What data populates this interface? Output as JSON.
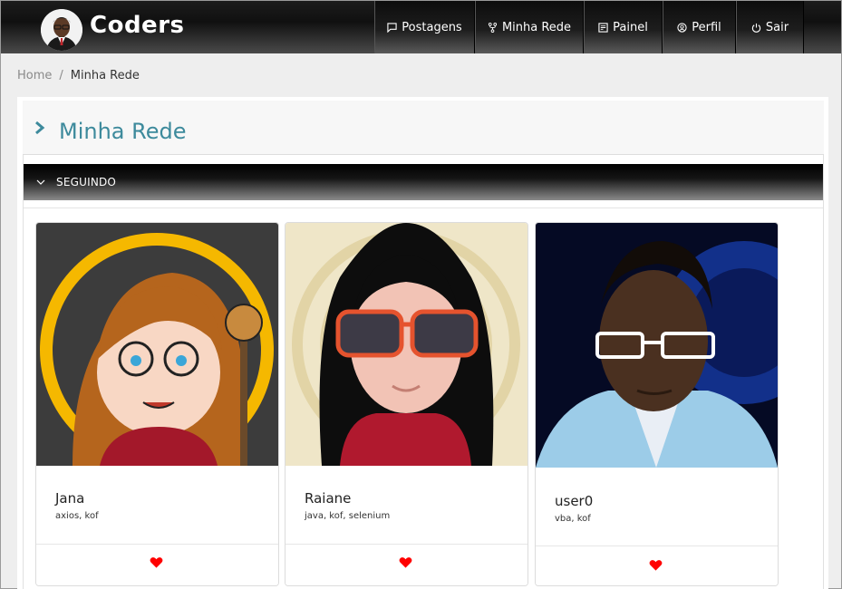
{
  "header": {
    "brand": "Coders",
    "nav": [
      {
        "label": "Postagens",
        "icon": "chat-icon"
      },
      {
        "label": "Minha Rede",
        "icon": "network-icon"
      },
      {
        "label": "Painel",
        "icon": "dashboard-icon"
      },
      {
        "label": "Perfil",
        "icon": "user-circle-icon"
      },
      {
        "label": "Sair",
        "icon": "power-icon"
      }
    ]
  },
  "breadcrumb": {
    "home": "Home",
    "separator": "/",
    "current": "Minha Rede"
  },
  "page": {
    "title": "Minha Rede"
  },
  "section": {
    "label": "SEGUINDO"
  },
  "cards": [
    {
      "name": "Jana",
      "tags": "axios, kof"
    },
    {
      "name": "Raiane",
      "tags": "java, kof, selenium"
    },
    {
      "name": "user0",
      "tags": "vba, kof"
    }
  ],
  "colors": {
    "accent": "#3d8a9c",
    "heart": "#ff0000"
  }
}
